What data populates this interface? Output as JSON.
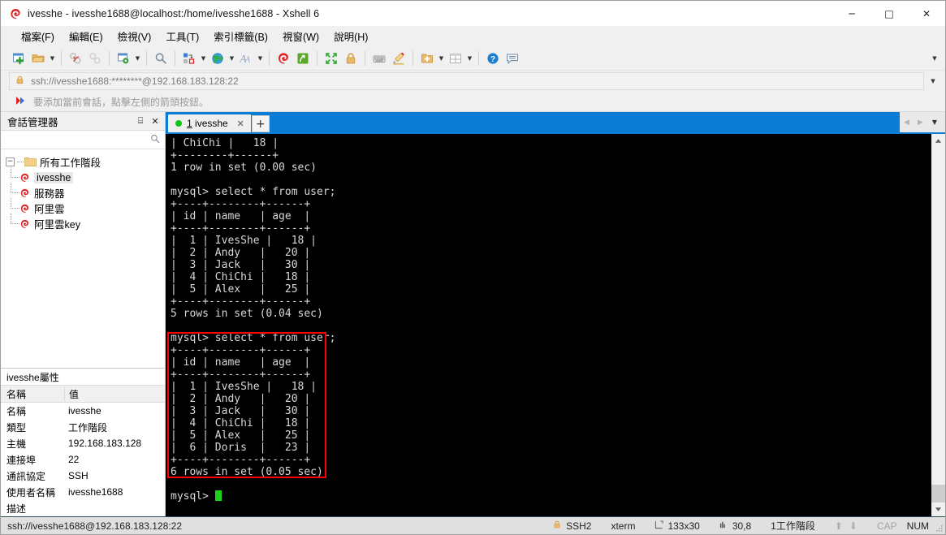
{
  "window": {
    "title": "ivesshe - ivesshe1688@localhost:/home/ivesshe1688 - Xshell 6",
    "minimize_label": "─",
    "maximize_label": "□",
    "close_label": "✕"
  },
  "menu": {
    "items": [
      {
        "label": "檔案(F)",
        "name": "menu-file"
      },
      {
        "label": "編輯(E)",
        "name": "menu-edit"
      },
      {
        "label": "檢視(V)",
        "name": "menu-view"
      },
      {
        "label": "工具(T)",
        "name": "menu-tools"
      },
      {
        "label": "索引標籤(B)",
        "name": "menu-tabs"
      },
      {
        "label": "視窗(W)",
        "name": "menu-window"
      },
      {
        "label": "說明(H)",
        "name": "menu-help"
      }
    ]
  },
  "toolbar": {
    "overflow_caret": "▼",
    "buttons": [
      {
        "name": "new-session-icon",
        "tip": "新建工作階段"
      },
      {
        "name": "open-folder-icon",
        "tip": "開啟"
      },
      {
        "name": "disconnect-icon",
        "tip": "中斷連線"
      },
      {
        "name": "reconnect-icon",
        "tip": "重新連線"
      },
      {
        "name": "session-properties-icon",
        "tip": "內容"
      },
      {
        "name": "find-icon",
        "tip": "尋找"
      },
      {
        "name": "transfer-icon",
        "tip": "傳送"
      },
      {
        "name": "globe-icon",
        "tip": "網頁"
      },
      {
        "name": "font-icon",
        "tip": "字型"
      },
      {
        "name": "xshell-icon",
        "tip": "Xshell"
      },
      {
        "name": "xftp-icon",
        "tip": "Xftp"
      },
      {
        "name": "fullscreen-icon",
        "tip": "全螢幕"
      },
      {
        "name": "lock-icon",
        "tip": "鎖定"
      },
      {
        "name": "keyboard-icon",
        "tip": "鍵盤"
      },
      {
        "name": "highlight-icon",
        "tip": "標示"
      },
      {
        "name": "add-tab-icon",
        "tip": "新增索引標籤"
      },
      {
        "name": "layout-icon",
        "tip": "排列"
      },
      {
        "name": "help-icon",
        "tip": "說明"
      },
      {
        "name": "chat-icon",
        "tip": "對話"
      }
    ]
  },
  "address": {
    "value": "ssh://ivesshe1688:********@192.168.183.128:22",
    "lock_icon": "lock-icon",
    "caret": "▼"
  },
  "hint": {
    "text": "要添加當前會話，點擊左側的箭頭按鈕。"
  },
  "sidebar": {
    "title": "會話管理器",
    "pin_label": "⌸",
    "close_label": "✕",
    "search_placeholder": "",
    "search_value": "",
    "tree": {
      "root_label": "所有工作階段",
      "root_toggle": "−",
      "items": [
        {
          "label": "ivesshe",
          "selected": true
        },
        {
          "label": "服務器",
          "selected": false
        },
        {
          "label": "阿里雲",
          "selected": false
        },
        {
          "label": "阿里雲key",
          "selected": false
        }
      ]
    },
    "properties": {
      "title": "ivesshe屬性",
      "header": {
        "name": "名稱",
        "value": "值"
      },
      "rows": [
        {
          "name": "名稱",
          "value": "ivesshe"
        },
        {
          "name": "類型",
          "value": "工作階段"
        },
        {
          "name": "主機",
          "value": "192.168.183.128"
        },
        {
          "name": "連接埠",
          "value": "22"
        },
        {
          "name": "通訊協定",
          "value": "SSH"
        },
        {
          "name": "使用者名稱",
          "value": "ivesshe1688"
        },
        {
          "name": "描述",
          "value": ""
        }
      ]
    }
  },
  "tabs": {
    "active": {
      "index_label": "1",
      "label": " ivesshe",
      "close_label": "✕",
      "status_color": "#16c416"
    },
    "new_tab_label": "+",
    "nav_prev": "◀",
    "nav_next": "▶",
    "nav_caret": "▼"
  },
  "terminal": {
    "lines": [
      "| ChiChi |   18 |",
      "+--------+------+",
      "1 row in set (0.00 sec)",
      "",
      "mysql> select * from user;",
      "+----+--------+------+",
      "| id | name   | age  |",
      "+----+--------+------+",
      "|  1 | IvesShe |   18 |",
      "|  2 | Andy   |   20 |",
      "|  3 | Jack   |   30 |",
      "|  4 | ChiChi |   18 |",
      "|  5 | Alex   |   25 |",
      "+----+--------+------+",
      "5 rows in set (0.04 sec)",
      "",
      "mysql> select * from user;",
      "+----+--------+------+",
      "| id | name   | age  |",
      "+----+--------+------+",
      "|  1 | IvesShe |   18 |",
      "|  2 | Andy   |   20 |",
      "|  3 | Jack   |   30 |",
      "|  4 | ChiChi |   18 |",
      "|  5 | Alex   |   25 |",
      "|  6 | Doris  |   23 |",
      "+----+--------+------+",
      "6 rows in set (0.05 sec)",
      "",
      "mysql> "
    ],
    "prompt": "mysql> ",
    "highlight_color": "#ff0000",
    "bg": "#000000",
    "fg": "#d8d8d8",
    "cursor_color": "#19d219",
    "scroll_up": "︿",
    "scroll_down": "﹀"
  },
  "statusbar": {
    "connection": "ssh://ivesshe1688@192.168.183.128:22",
    "protocol": "SSH2",
    "term_type": "xterm",
    "size": "133x30",
    "cursor_pos": "30,8",
    "sessions": "1工作階段",
    "cap": "CAP",
    "num": "NUM",
    "up_arrow": "⬆",
    "down_arrow": "⬇"
  }
}
